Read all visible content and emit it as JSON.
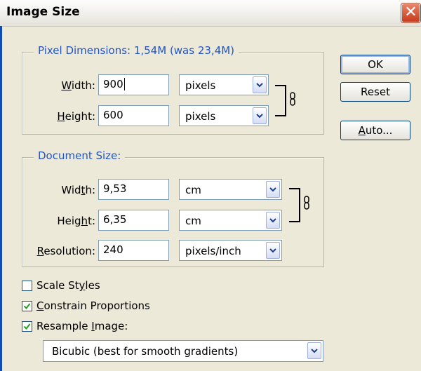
{
  "dialog": {
    "title": "Image Size"
  },
  "icons": {
    "close": "close-icon",
    "link": "chain-link-icon",
    "dropdown": "dropdown-arrow-icon",
    "check": "checkmark-icon"
  },
  "pixel_dimensions": {
    "legend": "Pixel Dimensions:  1,54M (was 23,4M)",
    "width": {
      "label_pre": "",
      "label_key": "W",
      "label_post": "idth:",
      "value": "900",
      "unit": "pixels"
    },
    "height": {
      "label_pre": "",
      "label_key": "H",
      "label_post": "eight:",
      "value": "600",
      "unit": "pixels"
    }
  },
  "document_size": {
    "legend": "Document Size:",
    "width": {
      "label_pre": "Wid",
      "label_key": "t",
      "label_post": "h:",
      "value": "9,53",
      "unit": "cm"
    },
    "height": {
      "label_pre": "Heig",
      "label_key": "h",
      "label_post": "t:",
      "value": "6,35",
      "unit": "cm"
    },
    "resolution": {
      "label_pre": "",
      "label_key": "R",
      "label_post": "esolution:",
      "value": "240",
      "unit": "pixels/inch"
    }
  },
  "buttons": {
    "ok": "OK",
    "reset": "Reset",
    "auto_key": "A",
    "auto_post": "uto..."
  },
  "options": {
    "scale_styles": {
      "pre": "Scale St",
      "key": "y",
      "post": "les",
      "checked": false
    },
    "constrain": {
      "pre": "",
      "key": "C",
      "post": "onstrain Proportions",
      "checked": true
    },
    "resample": {
      "pre": "Resample ",
      "key": "I",
      "post": "mage:",
      "checked": true
    }
  },
  "resample_method": "Bicubic (best for smooth gradients)"
}
